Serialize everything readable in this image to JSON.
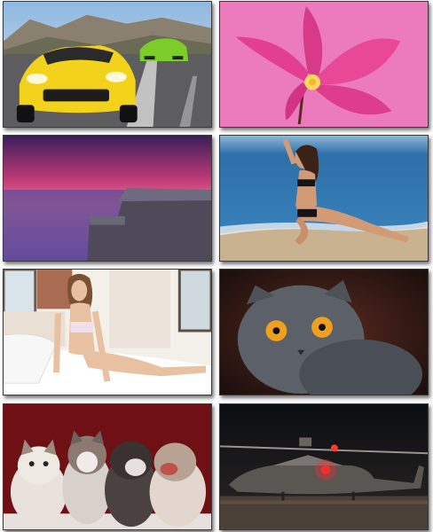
{
  "gallery": {
    "layout": "2-column grid",
    "tiles": [
      {
        "subject": "sports-cars-on-road",
        "accent": "#f2d21b"
      },
      {
        "subject": "pink-plumeria-flower",
        "accent": "#e06aa8"
      },
      {
        "subject": "purple-sunset-pier",
        "accent": "#c8508a"
      },
      {
        "subject": "woman-on-beach",
        "accent": "#3a78b0"
      },
      {
        "subject": "woman-on-bed",
        "accent": "#e9e4de"
      },
      {
        "subject": "grey-scottish-fold-cat",
        "accent": "#f0a020"
      },
      {
        "subject": "husky-puppies",
        "accent": "#7a1216"
      },
      {
        "subject": "attack-helicopter-at-night",
        "accent": "#ff2a2a"
      }
    ]
  }
}
